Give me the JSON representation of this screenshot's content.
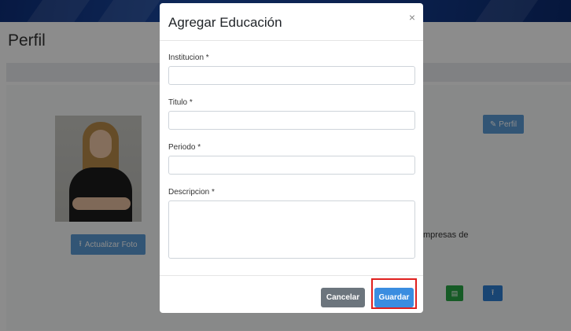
{
  "page": {
    "title": "Perfil",
    "upload_photo_label": "Actualizar Foto",
    "profile_button_label": "Perfil",
    "partial_text": "mpresas  de"
  },
  "modal": {
    "title": "Agregar Educación",
    "close_label": "×",
    "fields": [
      {
        "label": "Institucion *",
        "value": "",
        "placeholder": ""
      },
      {
        "label": "Titulo *",
        "value": "",
        "placeholder": ""
      },
      {
        "label": "Periodo *",
        "value": "",
        "placeholder": ""
      },
      {
        "label": "Descripcion *",
        "value": "",
        "placeholder": ""
      }
    ],
    "cancel_label": "Cancelar",
    "save_label": "Guardar"
  },
  "colors": {
    "primary": "#3a8de0",
    "secondary": "#6c757d",
    "success": "#28a745",
    "highlight": "#e0201e",
    "topbar": "#1b4aa3"
  },
  "icons": {
    "upload": "upload-icon",
    "pencil": "pencil-icon",
    "file": "file-icon",
    "close": "close-icon"
  }
}
